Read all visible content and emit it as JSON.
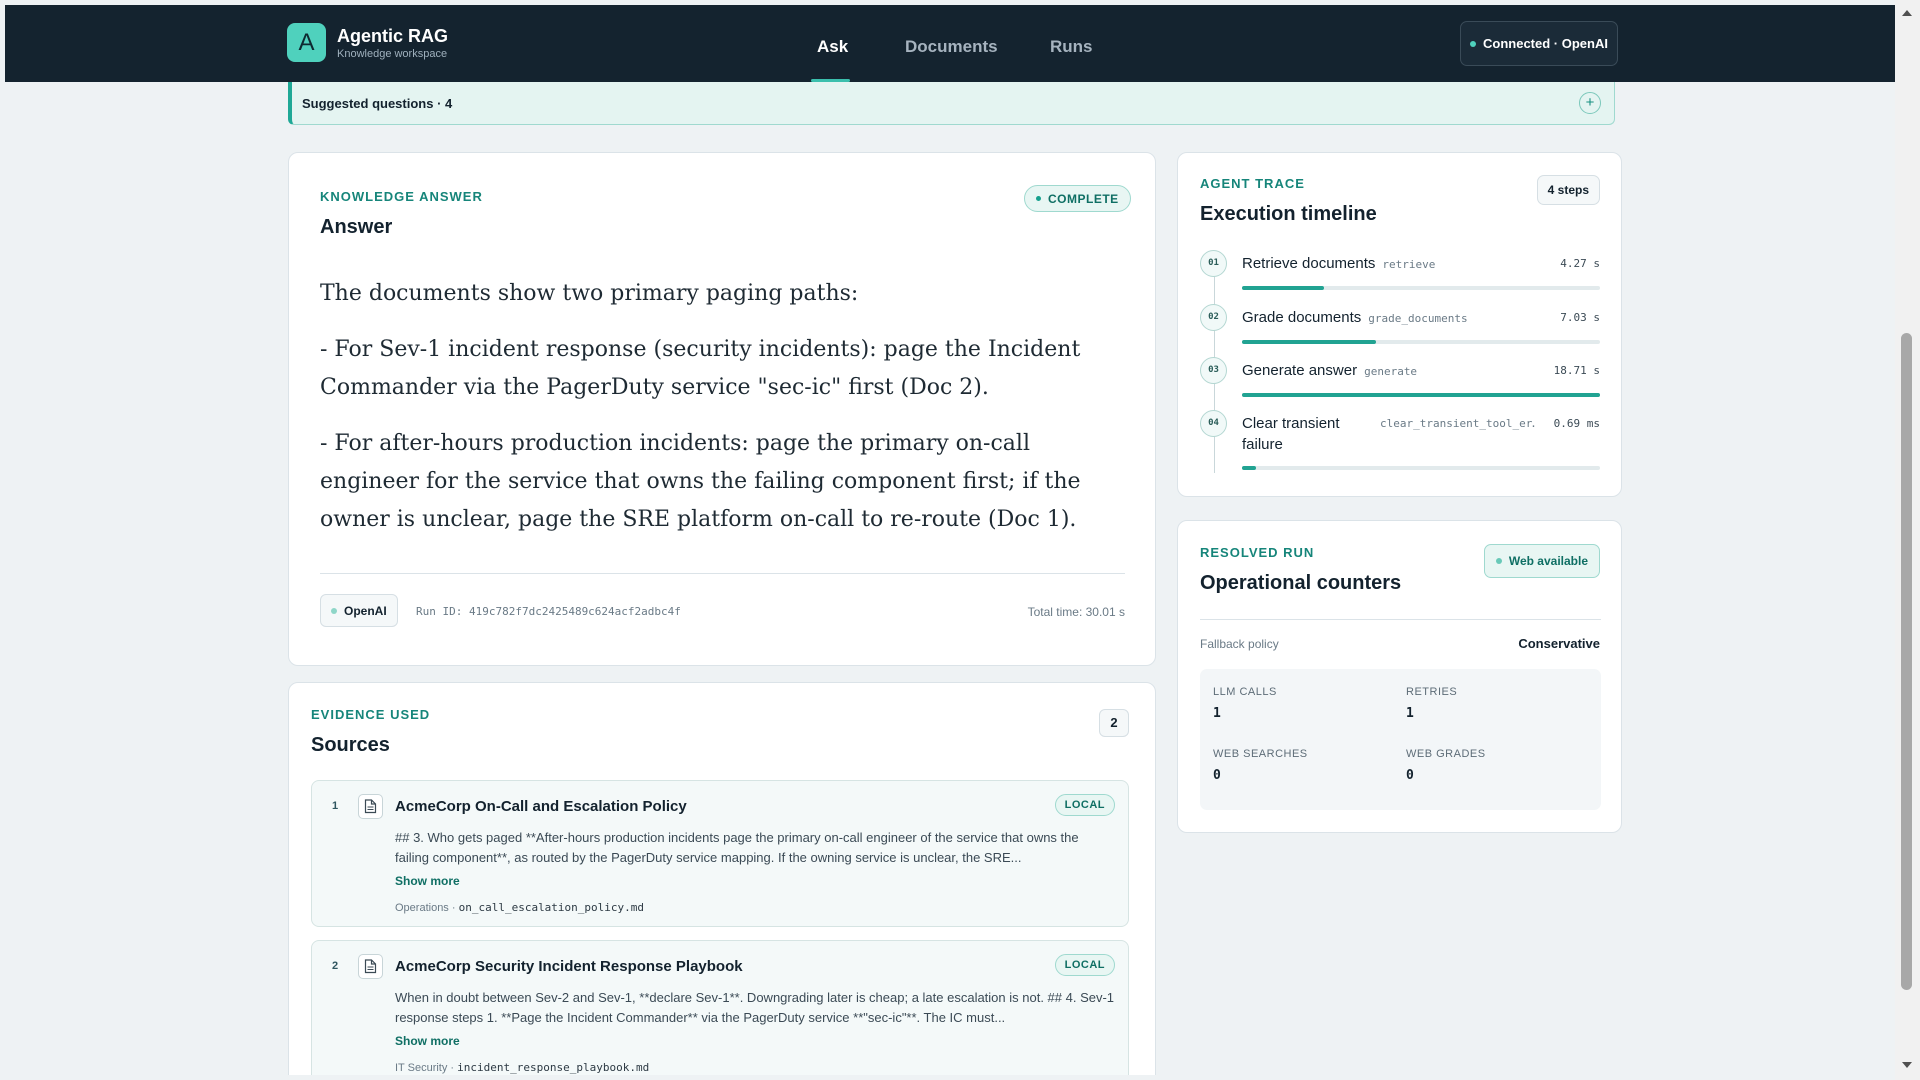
{
  "header": {
    "logo_letter": "A",
    "title": "Agentic RAG",
    "subtitle": "Knowledge workspace",
    "tabs": [
      {
        "label": "Ask",
        "active": true
      },
      {
        "label": "Documents",
        "active": false
      },
      {
        "label": "Runs",
        "active": false
      }
    ],
    "connection": "Connected · OpenAI"
  },
  "suggested": {
    "label": "Suggested questions · 4",
    "toggle_icon": "+"
  },
  "answer": {
    "eyebrow": "KNOWLEDGE ANSWER",
    "title": "Answer",
    "status": "COMPLETE",
    "paragraphs": [
      "The documents show two primary paging paths:",
      "- For Sev-1 incident response (security incidents): page the Incident Commander via the PagerDuty service \"sec-ic\" first (Doc 2).",
      "- For after-hours production incidents: page the primary on-call engineer for the service that owns the failing component first; if the owner is unclear, page the SRE platform on-call to re-route (Doc 1)."
    ],
    "provider": "OpenAI",
    "run_id": "Run ID: 419c782f7dc2425489c624acf2adbc4f",
    "total_time": "Total time: 30.01 s"
  },
  "sources": {
    "eyebrow": "EVIDENCE USED",
    "title": "Sources",
    "count": "2",
    "items": [
      {
        "num": "1",
        "title": "AcmeCorp On-Call and Escalation Policy",
        "badge": "LOCAL",
        "snippet": "## 3. Who gets paged **After-hours production incidents page the primary on-call engineer of the service that owns the failing component**, as routed by the PagerDuty service mapping. If the owning service is unclear, the SRE...",
        "show_more": "Show more",
        "category": "Operations",
        "file": "on_call_escalation_policy.md"
      },
      {
        "num": "2",
        "title": "AcmeCorp Security Incident Response Playbook",
        "badge": "LOCAL",
        "snippet": "When in doubt between Sev-2 and Sev-1, **declare Sev-1**. Downgrading later is cheap; a late escalation is not. ## 4. Sev-1 response steps 1. **Page the Incident Commander** via the PagerDuty service **\"sec-ic\"**. The IC must...",
        "show_more": "Show more",
        "category": "IT Security",
        "file": "incident_response_playbook.md"
      }
    ]
  },
  "trace": {
    "eyebrow": "AGENT TRACE",
    "title": "Execution timeline",
    "steps_badge": "4 steps",
    "steps": [
      {
        "num": "01",
        "name": "Retrieve documents",
        "code": "retrieve",
        "time": "4.27 s",
        "progress": 0.23
      },
      {
        "num": "02",
        "name": "Grade documents",
        "code": "grade_documents",
        "time": "7.03 s",
        "progress": 0.375
      },
      {
        "num": "03",
        "name": "Generate answer",
        "code": "generate",
        "time": "18.71 s",
        "progress": 1.0
      },
      {
        "num": "04",
        "name": "Clear transient failure",
        "code": "clear_transient_tool_er…",
        "time": "0.69 ms",
        "progress": 0.04
      }
    ]
  },
  "counters": {
    "eyebrow": "RESOLVED RUN",
    "title": "Operational counters",
    "web_status": "Web available",
    "policy_label": "Fallback policy",
    "policy_value": "Conservative",
    "metrics": [
      {
        "label": "LLM CALLS",
        "value": "1"
      },
      {
        "label": "RETRIES",
        "value": "1"
      },
      {
        "label": "WEB SEARCHES",
        "value": "0"
      },
      {
        "label": "WEB GRADES",
        "value": "0"
      }
    ]
  },
  "colors": {
    "header_bg": "#14232f",
    "accent": "#1fa896",
    "accent_light": "#4fd1bd",
    "page_bg": "#eef2f4"
  },
  "icons": {
    "source_item": "document-icon",
    "scroll_up": "arrow-up-icon",
    "scroll_down": "arrow-down-icon"
  }
}
